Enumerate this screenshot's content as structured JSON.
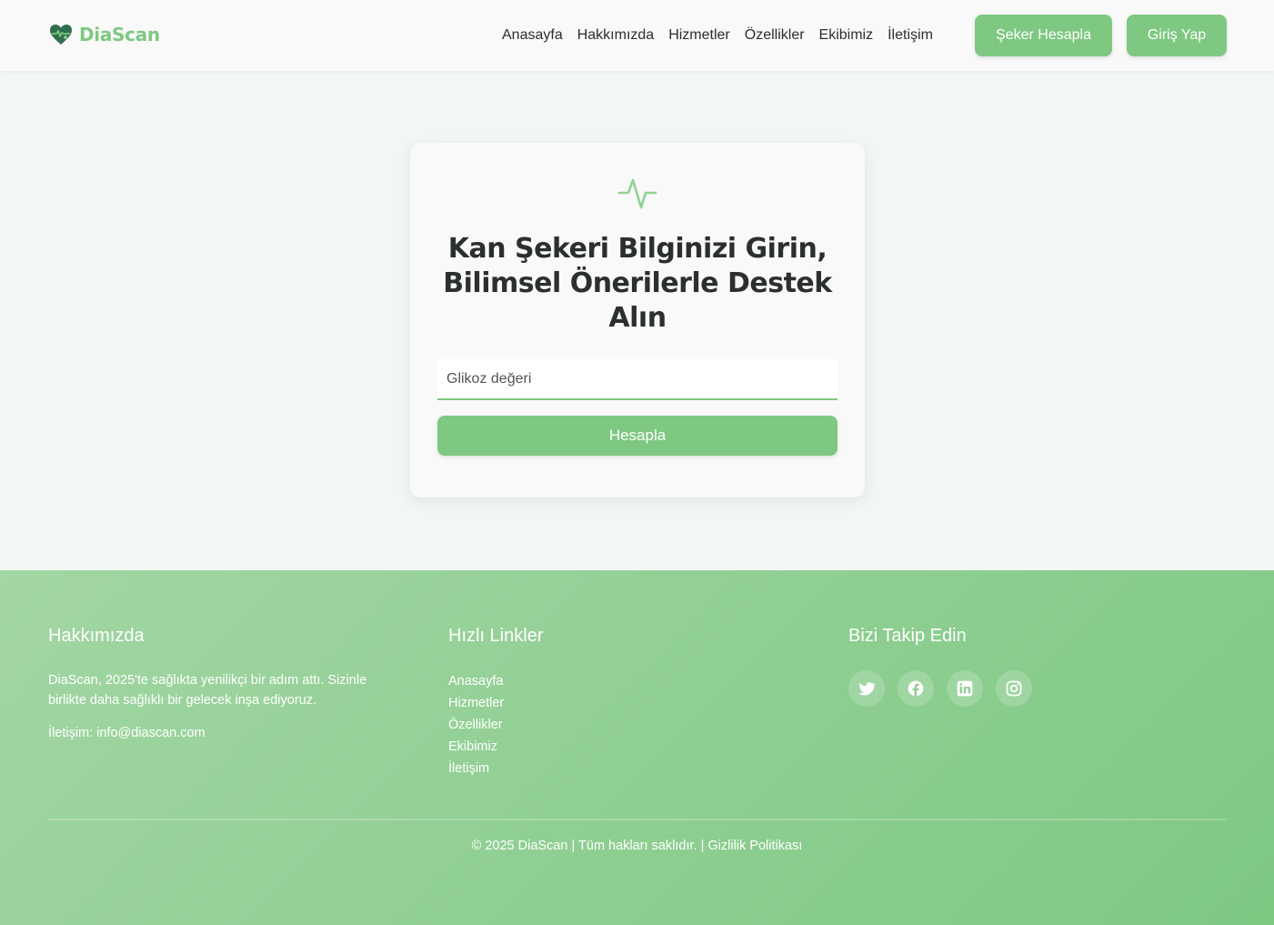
{
  "header": {
    "brand": "DiaScan",
    "logo_icon": "heart-pulse-icon",
    "nav": [
      "Anasayfa",
      "Hakkımızda",
      "Hizmetler",
      "Özellikler",
      "Ekibimiz",
      "İletişim"
    ],
    "calc_button": "Şeker Hesapla",
    "login_button": "Giriş Yap"
  },
  "card": {
    "icon": "activity-pulse-icon",
    "title": "Kan Şekeri Bilginizi Girin, Bilimsel Önerilerle Destek Alın",
    "input_placeholder": "Glikoz değeri",
    "input_value": "",
    "submit_label": "Hesapla"
  },
  "footer": {
    "about": {
      "heading": "Hakkımızda",
      "text": "DiaScan, 2025'te sağlıkta yenilikçi bir adım attı. Sizinle birlikte daha sağlıklı bir gelecek inşa ediyoruz.",
      "contact": "İletişim: info@diascan.com"
    },
    "links": {
      "heading": "Hızlı Linkler",
      "items": [
        "Anasayfa",
        "Hizmetler",
        "Özellikler",
        "Ekibimiz",
        "İletişim"
      ]
    },
    "social": {
      "heading": "Bizi Takip Edin",
      "icons": [
        "twitter-icon",
        "facebook-icon",
        "linkedin-icon",
        "instagram-icon"
      ]
    },
    "copyright": "© 2025 DiaScan | Tüm hakları saklıdır. | Gizlilik Politikası"
  },
  "colors": {
    "accent": "#7ec882",
    "page_bg": "#f2f7f4",
    "header_bg": "#f9f9f9",
    "text": "#2b2f2d"
  }
}
